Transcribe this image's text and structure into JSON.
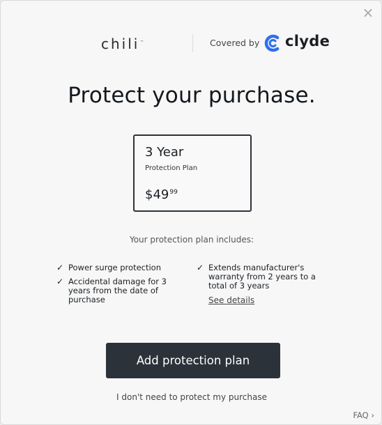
{
  "modal": {
    "close_icon": "×",
    "brand": {
      "store_name": "chili",
      "store_mark": "™",
      "covered_by": "Covered by",
      "partner_name": "clyde"
    },
    "title": "Protect your purchase.",
    "plan": {
      "term": "3 Year",
      "subtitle": "Protection Plan",
      "price_main": "$49",
      "price_cents": "99"
    },
    "includes_label": "Your protection plan includes:",
    "features": {
      "col1": [
        "Power surge protection",
        "Accidental damage for 3 years from the date of purchase"
      ],
      "col2": [
        "Extends manufacturer's warranty from 2 years to a total of 3 years"
      ]
    },
    "see_details": "See details",
    "cta": "Add protection plan",
    "decline": "I don't need to protect my purchase",
    "faq": "FAQ",
    "faq_chevron": "›",
    "check_glyph": "✓"
  },
  "colors": {
    "accent_dark": "#2b323a",
    "clyde_blue": "#2f6ff0",
    "background": "#f7f7f7"
  }
}
